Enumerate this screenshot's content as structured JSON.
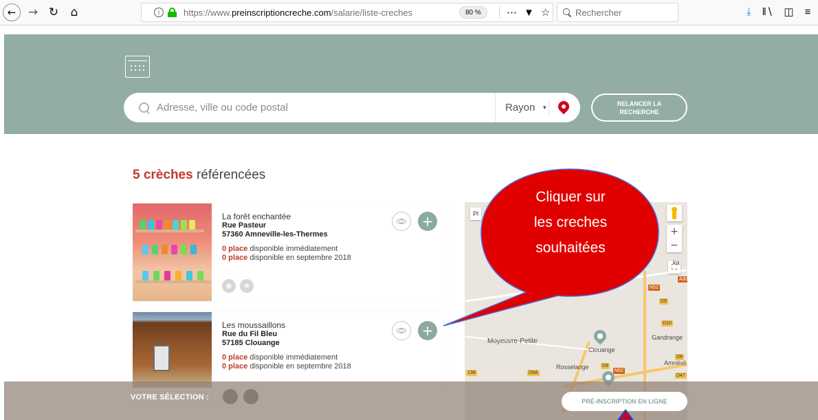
{
  "browser": {
    "url_prefix": "https://www.",
    "url_domain": "preinscriptioncreche.com",
    "url_path": "/salarie/liste-creches",
    "zoom": "80 %",
    "search_placeholder": "Rechercher",
    "icons": {
      "back": "arrow-left-icon",
      "forward": "arrow-right-icon",
      "reload": "reload-icon",
      "home": "home-icon",
      "more": "ellipsis-icon",
      "pocket": "pocket-icon",
      "bookmark": "star-icon",
      "download": "download-icon",
      "library": "library-icon",
      "sidebar": "sidebar-icon",
      "menu": "hamburger-menu-icon"
    }
  },
  "hero": {
    "search_placeholder": "Adresse, ville ou code postal",
    "radius_label": "Rayon",
    "relaunch_label": "RELANCER LA RECHERCHE",
    "background_color": "#93aca6"
  },
  "results": {
    "count": "5 crèches",
    "suffix": " référencées",
    "cards": [
      {
        "name": "La forêt enchantée",
        "street": "Rue Pasteur",
        "city": "57360 Amneville-les-Thermes",
        "avail_now_count": "0 place",
        "avail_now_text": " disponible immédiatement",
        "avail_later_count": "0 place",
        "avail_later_text": " disponible en septembre 2018"
      },
      {
        "name": "Les moussaillons",
        "street": "Rue du Fil Bleu",
        "city": "57185 Clouange",
        "avail_now_count": "0 place",
        "avail_now_text": " disponible immédiatement",
        "avail_later_count": "0 place",
        "avail_later_text": " disponible en septembre 2018"
      }
    ]
  },
  "map": {
    "type_label": "Pl",
    "labels": {
      "moyeuvre": "Moyeuvre-Petite",
      "clouange": "Clouange",
      "gandrange": "Gandrange",
      "rosselange": "Rosselange",
      "amneville": "Amnévil",
      "ka": "ka"
    },
    "roads": [
      "N52",
      "D9",
      "D10",
      "D8",
      "D47",
      "D9",
      "D9A",
      "N52",
      "A30",
      "138"
    ]
  },
  "callout": {
    "text_line1": "Cliquer sur",
    "text_line2": "les creches",
    "text_line3": "souhaitées",
    "color": "#e00000"
  },
  "selection_bar": {
    "label": "VOTRE SÉLECTION :",
    "button_label": "PRÉ-INSCRIPTION EN LIGNE"
  }
}
